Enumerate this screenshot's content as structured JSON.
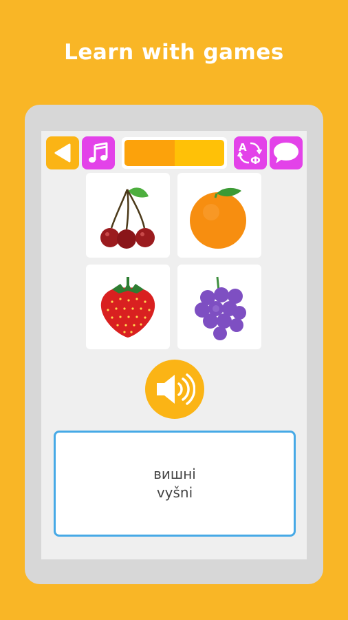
{
  "headline": "Learn with games",
  "toolbar": {
    "back_icon": "back-triangle-icon",
    "music_icon": "music-note-icon",
    "translit_icon": "transliteration-icon",
    "translit_glyphs": {
      "latin": "A",
      "cyrillic": "Ф"
    },
    "chat_icon": "speech-bubble-icon",
    "progress": 0.5
  },
  "cards": [
    {
      "icon": "cherries-icon"
    },
    {
      "icon": "orange-icon"
    },
    {
      "icon": "strawberry-icon"
    },
    {
      "icon": "grapes-icon"
    }
  ],
  "speaker_icon": "speaker-icon",
  "answer": {
    "native": "вишні",
    "transliteration": "vyšni"
  },
  "colors": {
    "background": "#F9B626",
    "accent_yellow": "#FBB415",
    "accent_magenta": "#E342E9",
    "answer_border": "#46A9E6"
  }
}
